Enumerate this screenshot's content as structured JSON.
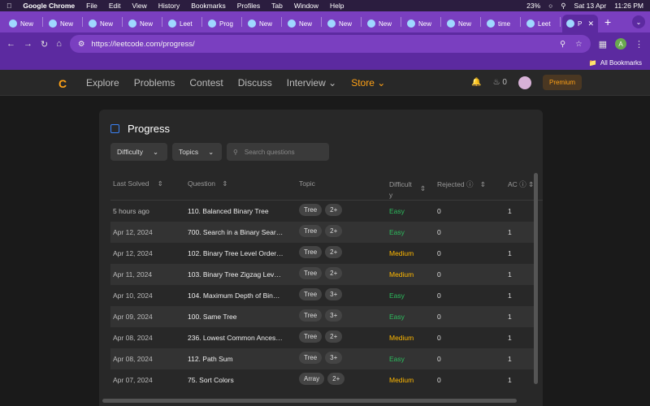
{
  "menubar": {
    "app": "Google Chrome",
    "items": [
      "File",
      "Edit",
      "View",
      "History",
      "Bookmarks",
      "Profiles",
      "Tab",
      "Window",
      "Help"
    ],
    "battery": "23%",
    "date": "Sat 13 Apr",
    "time": "11:26 PM"
  },
  "tabs": [
    {
      "label": "New"
    },
    {
      "label": "New"
    },
    {
      "label": "New"
    },
    {
      "label": "New"
    },
    {
      "label": "Leet"
    },
    {
      "label": "Prog"
    },
    {
      "label": "New"
    },
    {
      "label": "New"
    },
    {
      "label": "New"
    },
    {
      "label": "New"
    },
    {
      "label": "New"
    },
    {
      "label": "New"
    },
    {
      "label": "time"
    },
    {
      "label": "Leet"
    },
    {
      "label": "P",
      "active": true
    }
  ],
  "url": "https://leetcode.com/progress/",
  "bookmarks_label": "All Bookmarks",
  "profile_initial": "A",
  "nav": {
    "logo": "C",
    "items": [
      "Explore",
      "Problems",
      "Contest",
      "Discuss",
      "Interview"
    ],
    "store": "Store",
    "streak": "0",
    "premium": "Premium"
  },
  "page": {
    "title": "Progress",
    "filters": {
      "difficulty": "Difficulty",
      "topics": "Topics",
      "search_placeholder": "Search questions"
    }
  },
  "table": {
    "headers": {
      "last_solved": "Last Solved",
      "question": "Question",
      "topic": "Topic",
      "difficulty1": "Difficult",
      "difficulty2": "y",
      "rejected": "Rejected",
      "ac": "AC"
    },
    "rows": [
      {
        "last": "5 hours ago",
        "q": "110. Balanced Binary Tree",
        "topic": "Tree",
        "more": "2+",
        "diff": "Easy",
        "rej": "0",
        "ac": "1"
      },
      {
        "last": "Apr 12, 2024",
        "q": "700. Search in a Binary Search Tree",
        "topic": "Tree",
        "more": "2+",
        "diff": "Easy",
        "rej": "0",
        "ac": "1"
      },
      {
        "last": "Apr 12, 2024",
        "q": "102. Binary Tree Level Order Traversal",
        "topic": "Tree",
        "more": "2+",
        "diff": "Medium",
        "rej": "0",
        "ac": "1"
      },
      {
        "last": "Apr 11, 2024",
        "q": "103. Binary Tree Zigzag Level Order Traversal",
        "topic": "Tree",
        "more": "2+",
        "diff": "Medium",
        "rej": "0",
        "ac": "1"
      },
      {
        "last": "Apr 10, 2024",
        "q": "104. Maximum Depth of Binary Tree",
        "topic": "Tree",
        "more": "3+",
        "diff": "Easy",
        "rej": "0",
        "ac": "1"
      },
      {
        "last": "Apr 09, 2024",
        "q": "100. Same Tree",
        "topic": "Tree",
        "more": "3+",
        "diff": "Easy",
        "rej": "0",
        "ac": "1"
      },
      {
        "last": "Apr 08, 2024",
        "q": "236. Lowest Common Ancestor of a Binary Tree",
        "topic": "Tree",
        "more": "2+",
        "diff": "Medium",
        "rej": "0",
        "ac": "1"
      },
      {
        "last": "Apr 08, 2024",
        "q": "112. Path Sum",
        "topic": "Tree",
        "more": "3+",
        "diff": "Easy",
        "rej": "0",
        "ac": "1"
      },
      {
        "last": "Apr 07, 2024",
        "q": "75. Sort Colors",
        "topic": "Array",
        "more": "2+",
        "diff": "Medium",
        "rej": "0",
        "ac": "1"
      }
    ]
  }
}
